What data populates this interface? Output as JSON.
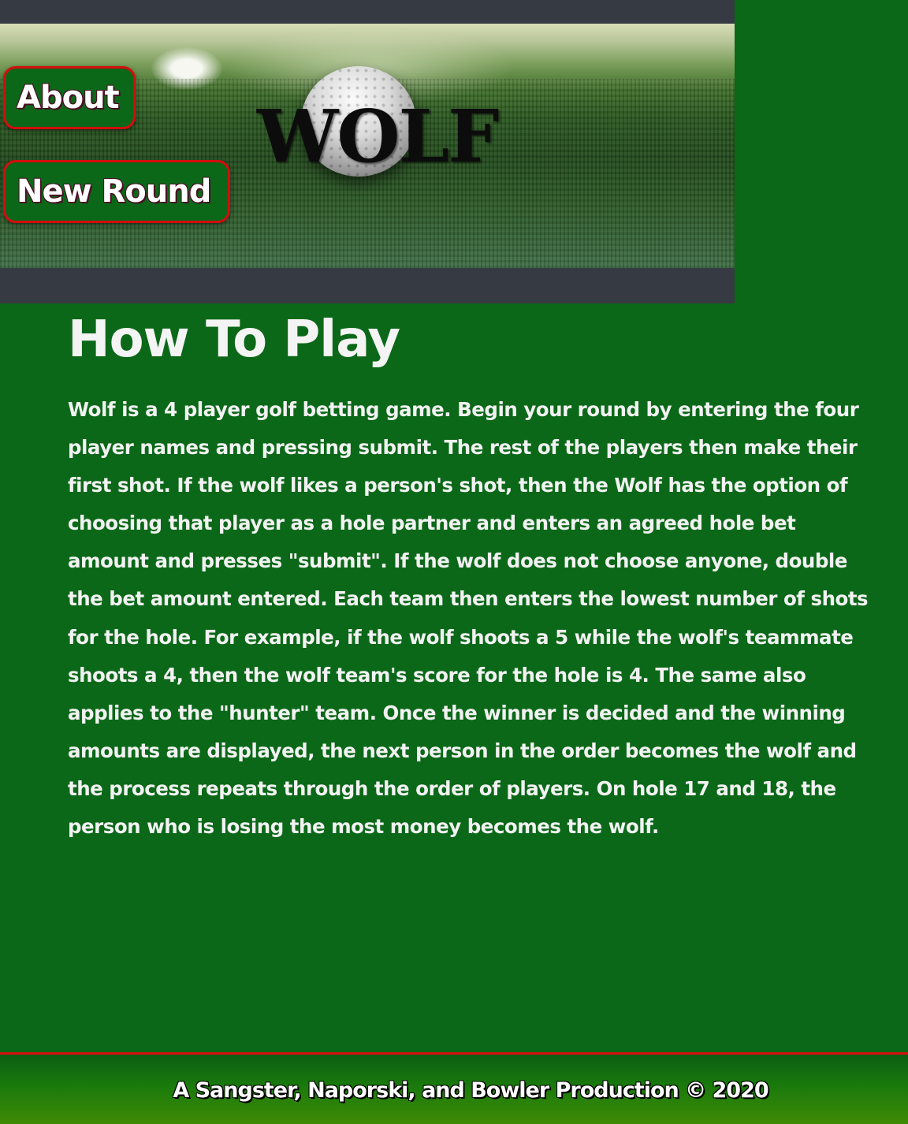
{
  "header": {
    "logo_text": "WOLF",
    "nav": {
      "about_label": "About",
      "new_round_label": "New Round"
    }
  },
  "main": {
    "title": "How To Play",
    "body": "Wolf is a 4 player golf betting game. Begin your round by entering the four player names and pressing submit. The rest of the players then make their first shot. If the wolf likes a person's shot, then the Wolf has the option of choosing that player as a hole partner and enters an agreed hole bet amount and presses \"submit\". If the wolf does not choose anyone, double the bet amount entered. Each team then enters the lowest number of shots for the hole. For example, if the wolf shoots a 5 while the wolf's teammate shoots a 4, then the wolf team's score for the hole is 4. The same also applies to the \"hunter\" team. Once the winner is decided and the winning amounts are displayed, the next person in the order becomes the wolf and the process repeats through the order of players. On hole 17 and 18, the person who is losing the most money becomes the wolf."
  },
  "footer": {
    "credit": "A Sangster, Naporski, and Bowler Production © 2020"
  },
  "colors": {
    "page_background": "#0b6818",
    "header_background": "#363a42",
    "button_border": "#d40d0d",
    "footer_border": "#d70f0f",
    "text": "#f2f2f2"
  }
}
